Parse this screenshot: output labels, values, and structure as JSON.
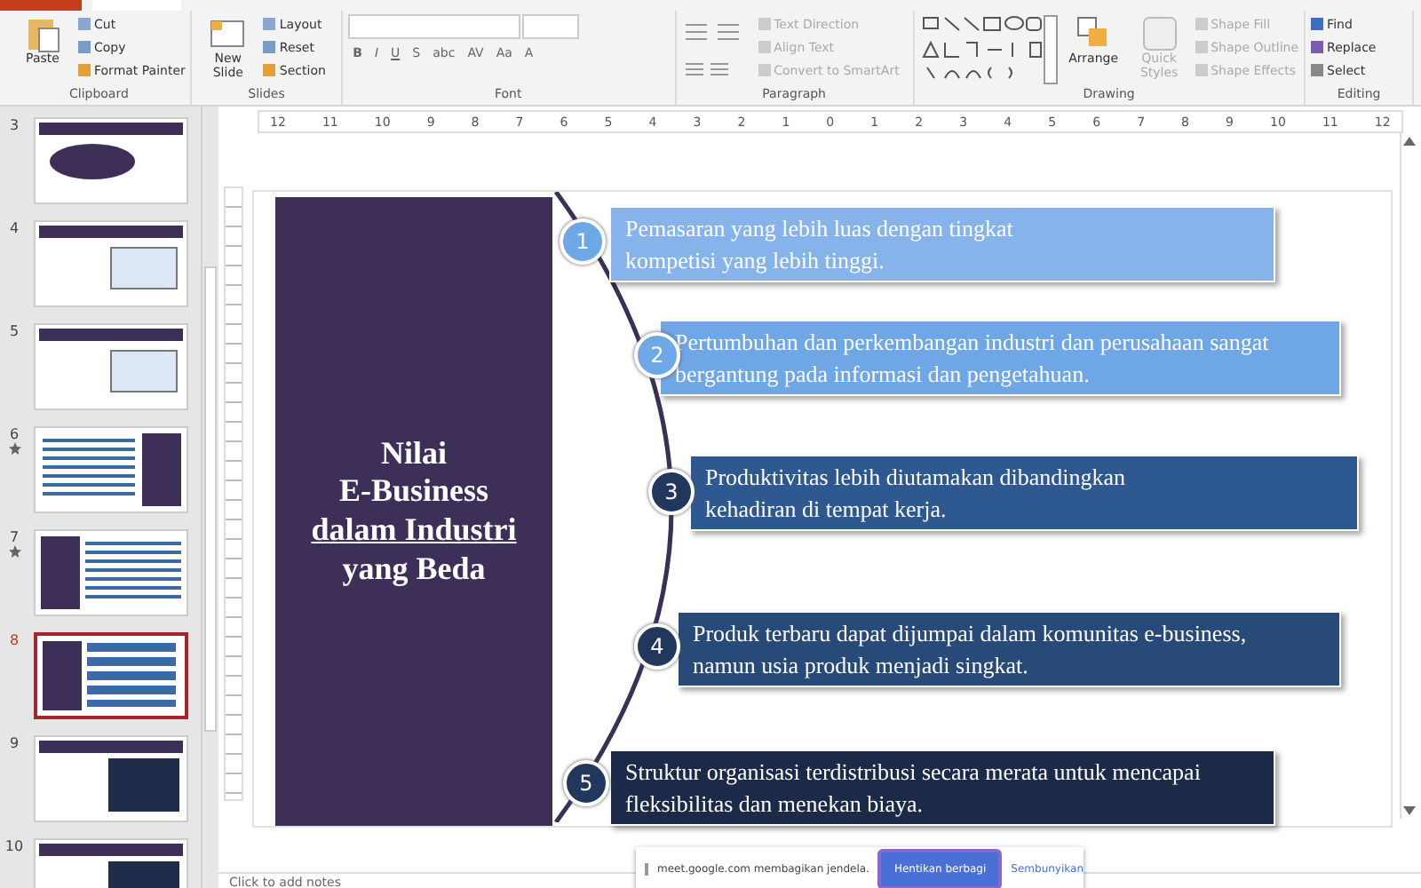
{
  "ribbon": {
    "groups": [
      {
        "kind": "clipboard",
        "label": "Clipboard",
        "big": "Paste",
        "items": [
          {
            "label": "Cut"
          },
          {
            "label": "Copy"
          },
          {
            "label": "Format Painter"
          }
        ]
      },
      {
        "kind": "slides",
        "label": "Slides",
        "big": "New Slide",
        "items": [
          {
            "label": "Layout"
          },
          {
            "label": "Reset"
          },
          {
            "label": "Section"
          }
        ]
      },
      {
        "kind": "font",
        "label": "Font",
        "items": [
          {
            "label": "B"
          },
          {
            "label": "I"
          },
          {
            "label": "U"
          },
          {
            "label": "S"
          },
          {
            "label": "abc"
          },
          {
            "label": "AV"
          },
          {
            "label": "Aa"
          },
          {
            "label": "A"
          }
        ]
      },
      {
        "kind": "paragraph",
        "label": "Paragraph",
        "items": [
          {
            "label": "Text Direction"
          },
          {
            "label": "Align Text"
          },
          {
            "label": "Convert to SmartArt"
          }
        ]
      },
      {
        "kind": "drawing",
        "label": "Drawing",
        "big": "Arrange",
        "big2": "Quick Styles",
        "items": [
          {
            "label": "Shape Fill"
          },
          {
            "label": "Shape Outline"
          },
          {
            "label": "Shape Effects"
          }
        ]
      },
      {
        "kind": "editing",
        "label": "Editing",
        "items": [
          {
            "label": "Find"
          },
          {
            "label": "Replace"
          },
          {
            "label": "Select"
          }
        ]
      }
    ]
  },
  "thumbnails": [
    {
      "number": "3",
      "starred": false,
      "selected": false,
      "kind": "bubble"
    },
    {
      "number": "4",
      "starred": false,
      "selected": false,
      "kind": "picture"
    },
    {
      "number": "5",
      "starred": false,
      "selected": false,
      "kind": "picture"
    },
    {
      "number": "6",
      "starred": true,
      "selected": false,
      "kind": "grid-right"
    },
    {
      "number": "7",
      "starred": true,
      "selected": false,
      "kind": "grid-left"
    },
    {
      "number": "8",
      "starred": false,
      "selected": true,
      "kind": "diagram"
    },
    {
      "number": "9",
      "starred": false,
      "selected": false,
      "kind": "text"
    },
    {
      "number": "10",
      "starred": false,
      "selected": false,
      "kind": "text"
    }
  ],
  "ruler": {
    "labels": [
      "12",
      "11",
      "10",
      "9",
      "8",
      "7",
      "6",
      "5",
      "4",
      "3",
      "2",
      "1",
      "0",
      "1",
      "2",
      "3",
      "4",
      "5",
      "6",
      "7",
      "8",
      "9",
      "10",
      "11",
      "12"
    ]
  },
  "slide": {
    "title_lines": [
      {
        "text": "Nilai",
        "underlined": false
      },
      {
        "text": "E-Business",
        "underlined": false
      },
      {
        "text": "dalam Industri",
        "underlined": true
      },
      {
        "text": "yang Beda",
        "underlined": false
      }
    ],
    "items": [
      {
        "number": "1",
        "lines": [
          "Pemasaran yang lebih luas dengan tingkat",
          "kompetisi yang lebih tinggi."
        ],
        "color": "#86b4ea"
      },
      {
        "number": "2",
        "lines": [
          "Pertumbuhan dan perkembangan industri dan perusahaan sangat",
          "bergantung pada informasi dan pengetahuan."
        ],
        "color": "#6ea6e6"
      },
      {
        "number": "3",
        "lines": [
          "Produktivitas lebih diutamakan dibandingkan",
          "kehadiran di tempat kerja."
        ],
        "color": "#2d5990"
      },
      {
        "number": "4",
        "lines": [
          "Produk terbaru dapat dijumpai dalam komunitas e-business,",
          "namun usia produk menjadi singkat."
        ],
        "color": "#284a78"
      },
      {
        "number": "5",
        "lines": [
          "Struktur organisasi terdistribusi secara merata untuk mencapai",
          "fleksibilitas dan menekan biaya."
        ],
        "color": "#1b2a49"
      }
    ]
  },
  "share_bar": {
    "message": "meet.google.com membagikan jendela.",
    "stop_button": "Hentikan berbagi",
    "hide_link": "Sembunyikan"
  },
  "notes": {
    "placeholder": "Click to add notes"
  }
}
